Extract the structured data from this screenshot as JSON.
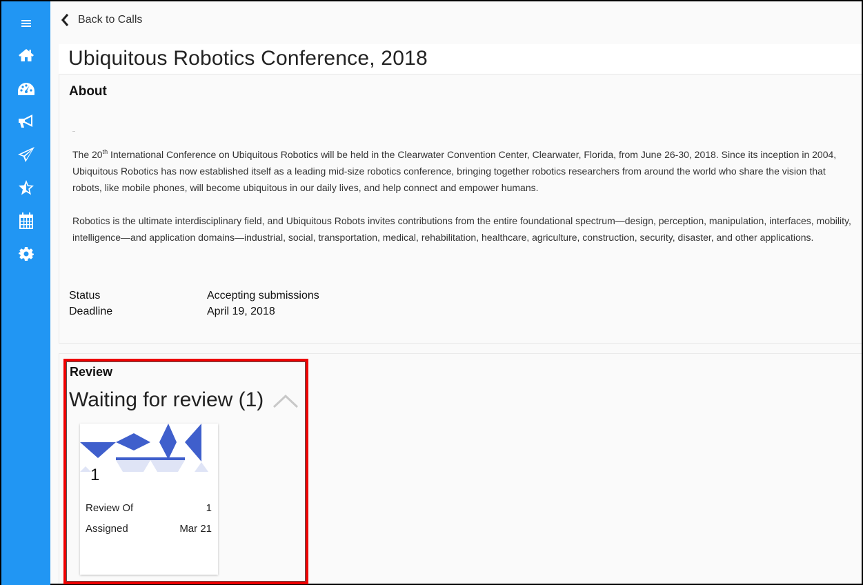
{
  "sidebar": {
    "items": [
      {
        "icon": "menu-icon",
        "label": "Menu"
      },
      {
        "icon": "home-icon",
        "label": "Home"
      },
      {
        "icon": "dashboard-icon",
        "label": "Dashboard"
      },
      {
        "icon": "megaphone-icon",
        "label": "Calls"
      },
      {
        "icon": "paper-plane-icon",
        "label": "Submissions"
      },
      {
        "icon": "star-half-icon",
        "label": "Reviews"
      },
      {
        "icon": "calendar-icon",
        "label": "Calendar"
      },
      {
        "icon": "gear-icon",
        "label": "Settings"
      }
    ],
    "color": "#2196f3"
  },
  "header": {
    "back_label": "Back to Calls",
    "title": "Ubiquitous Robotics Conference, 2018"
  },
  "about": {
    "heading": "About",
    "p1_pre": "The 20",
    "p1_sup": "th",
    "p1_post": " International Conference on Ubiquitous Robotics will be held in the Clearwater Convention Center, Clearwater, Florida, from June 26-30, 2018. Since its inception in 2004, Ubiquitous Robotics has now established itself as a leading mid-size robotics conference, bringing together robotics researchers from around the world who share the vision that robots, like mobile phones, will become ubiquitous in our daily lives, and help connect and empower humans.",
    "p2": "Robotics is the ultimate interdisciplinary field, and Ubiquitous Robots invites contributions from the entire foundational spectrum—design, perception, manipulation, interfaces, mobility, intelligence—and application domains—industrial, social, transportation, medical, rehabilitation, healthcare, agriculture, construction, security, disaster, and other applications.",
    "status_label": "Status",
    "status_value": "Accepting submissions",
    "deadline_label": "Deadline",
    "deadline_value": "April 19, 2018"
  },
  "review": {
    "heading": "Review",
    "group_title": "Waiting for review (1)",
    "cards": [
      {
        "number": "1",
        "review_of_label": "Review Of",
        "review_of_value": "1",
        "assigned_label": "Assigned",
        "assigned_value": "Mar 21",
        "pattern_color": "#3f5fcc"
      }
    ]
  },
  "annotation": {
    "highlight_color": "#ee0000"
  }
}
